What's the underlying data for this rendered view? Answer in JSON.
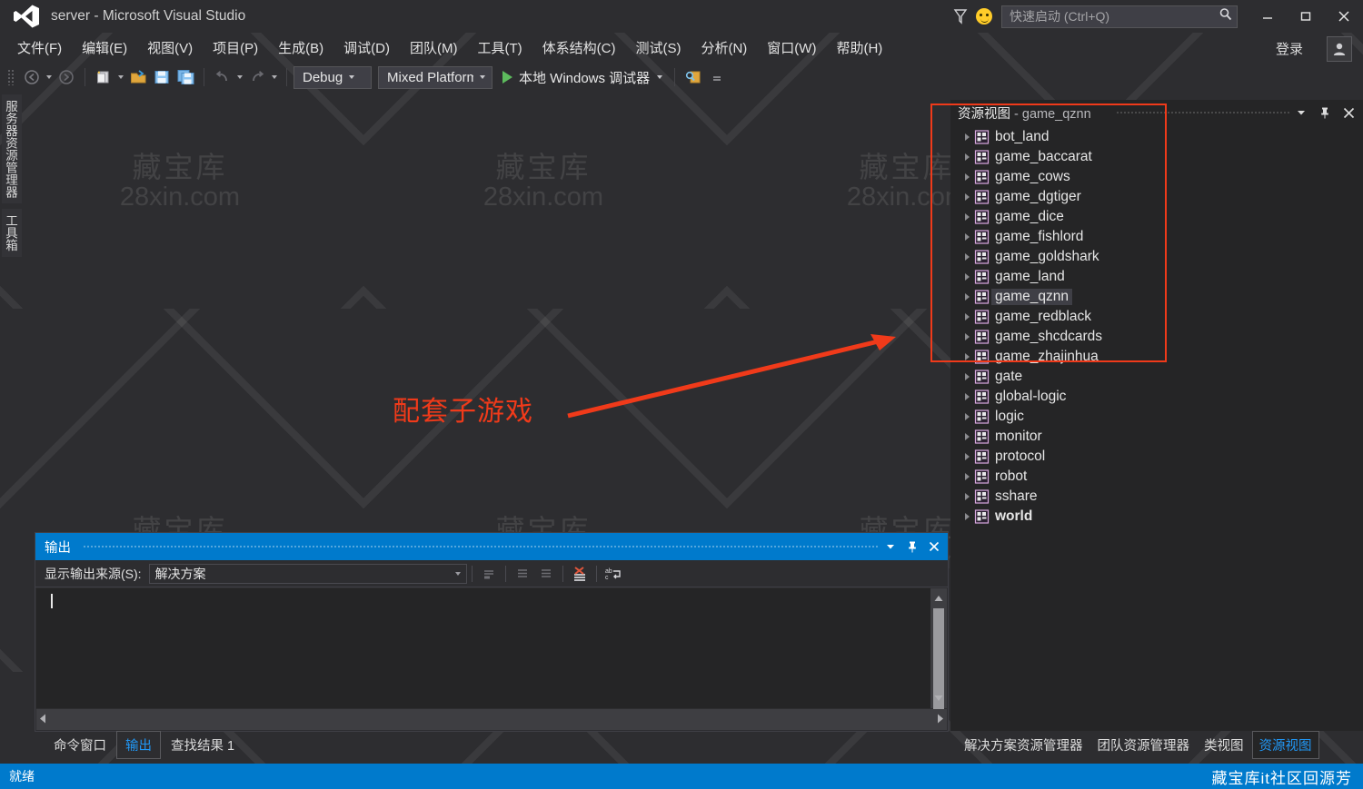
{
  "window": {
    "title": "server - Microsoft Visual Studio",
    "logo_icon": "visual-studio-logo",
    "minimize_icon": "minimize-icon",
    "maximize_icon": "maximize-icon",
    "close_icon": "close-icon",
    "feedback_icon": "smiley-feedback-icon",
    "funnel_icon": "funnel-icon",
    "signin_label": "登录",
    "avatar_icon": "user-avatar-icon"
  },
  "quick_launch": {
    "placeholder": "快速启动 (Ctrl+Q)",
    "value": "",
    "search_icon": "search-icon"
  },
  "menubar": {
    "items": [
      {
        "text": "文件(F)",
        "accel": "F"
      },
      {
        "text": "编辑(E)",
        "accel": "E"
      },
      {
        "text": "视图(V)",
        "accel": "V"
      },
      {
        "text": "项目(P)",
        "accel": "P"
      },
      {
        "text": "生成(B)",
        "accel": "B"
      },
      {
        "text": "调试(D)",
        "accel": "D"
      },
      {
        "text": "团队(M)",
        "accel": "M"
      },
      {
        "text": "工具(T)",
        "accel": "T"
      },
      {
        "text": "体系结构(C)",
        "accel": "C"
      },
      {
        "text": "测试(S)",
        "accel": "S"
      },
      {
        "text": "分析(N)",
        "accel": "N"
      },
      {
        "text": "窗口(W)",
        "accel": "W"
      },
      {
        "text": "帮助(H)",
        "accel": "H"
      }
    ]
  },
  "toolbar": {
    "navigate_back_icon": "navigate-back-icon",
    "navigate_forward_icon": "navigate-forward-icon",
    "new_item_icon": "new-item-icon",
    "open_file_icon": "open-file-icon",
    "save_icon": "save-icon",
    "save_all_icon": "save-all-icon",
    "undo_icon": "undo-icon",
    "redo_icon": "redo-icon",
    "configuration": "Debug",
    "platform": "Mixed Platforms",
    "run_label": "本地 Windows 调试器",
    "run_icon": "play-icon",
    "find_icon": "find-in-files-icon",
    "overflow_icon": "toolbar-overflow-icon"
  },
  "left_rail": {
    "tabs": [
      {
        "label": "服务器资源管理器"
      },
      {
        "label": "工具箱"
      }
    ]
  },
  "annotation": {
    "text": "配套子游戏",
    "color": "#f03a1a",
    "arrow_icon": "red-arrow-icon"
  },
  "output_pane": {
    "title": "输出",
    "dropdown_icon": "chevron-down-icon",
    "pin_icon": "pin-icon",
    "close_icon": "close-icon",
    "source_label": "显示输出来源(S):",
    "source_label_accel": "S",
    "source_value": "解决方案",
    "buttons": [
      {
        "icon": "goto-message-icon"
      },
      {
        "icon": "goto-previous-message-icon"
      },
      {
        "icon": "goto-next-message-icon"
      },
      {
        "icon": "clear-all-icon"
      },
      {
        "icon": "toggle-word-wrap-icon"
      }
    ],
    "content": "",
    "scroll_up_icon": "scroll-up-icon",
    "scroll_down_icon": "scroll-down-icon",
    "scroll_left_icon": "scroll-left-icon",
    "scroll_right_icon": "scroll-right-icon"
  },
  "bottom_tabs": {
    "items": [
      {
        "label": "命令窗口",
        "active": false
      },
      {
        "label": "输出",
        "active": true
      },
      {
        "label": "查找结果 1",
        "active": false
      }
    ]
  },
  "resource_view": {
    "title_prefix": "资源视图",
    "title_separator": "-",
    "title_project": "game_qznn",
    "dropdown_icon": "chevron-down-icon",
    "pin_icon": "pin-icon",
    "close_icon": "close-icon",
    "node_icon": "resource-project-icon",
    "expander_icon": "chevron-right-icon",
    "nodes": [
      {
        "label": "bot_land",
        "selected": false,
        "bold": false
      },
      {
        "label": "game_baccarat",
        "selected": false,
        "bold": false
      },
      {
        "label": "game_cows",
        "selected": false,
        "bold": false
      },
      {
        "label": "game_dgtiger",
        "selected": false,
        "bold": false
      },
      {
        "label": "game_dice",
        "selected": false,
        "bold": false
      },
      {
        "label": "game_fishlord",
        "selected": false,
        "bold": false
      },
      {
        "label": "game_goldshark",
        "selected": false,
        "bold": false
      },
      {
        "label": "game_land",
        "selected": false,
        "bold": false
      },
      {
        "label": "game_qznn",
        "selected": true,
        "bold": false
      },
      {
        "label": "game_redblack",
        "selected": false,
        "bold": false
      },
      {
        "label": "game_shcdcards",
        "selected": false,
        "bold": false
      },
      {
        "label": "game_zhajinhua",
        "selected": false,
        "bold": false
      },
      {
        "label": "gate",
        "selected": false,
        "bold": false
      },
      {
        "label": "global-logic",
        "selected": false,
        "bold": false
      },
      {
        "label": "logic",
        "selected": false,
        "bold": false
      },
      {
        "label": "monitor",
        "selected": false,
        "bold": false
      },
      {
        "label": "protocol",
        "selected": false,
        "bold": false
      },
      {
        "label": "robot",
        "selected": false,
        "bold": false
      },
      {
        "label": "sshare",
        "selected": false,
        "bold": false
      },
      {
        "label": "world",
        "selected": false,
        "bold": true
      }
    ]
  },
  "right_bottom_tabs": {
    "items": [
      {
        "label": "解决方案资源管理器",
        "active": false
      },
      {
        "label": "团队资源管理器",
        "active": false
      },
      {
        "label": "类视图",
        "active": false
      },
      {
        "label": "资源视图",
        "active": true
      }
    ]
  },
  "statusbar": {
    "text": "就绪",
    "watermark": "藏宝库it社区回源芳",
    "color": "#007acc"
  },
  "watermark": {
    "cn": "藏宝库",
    "en": "28xin.com"
  }
}
